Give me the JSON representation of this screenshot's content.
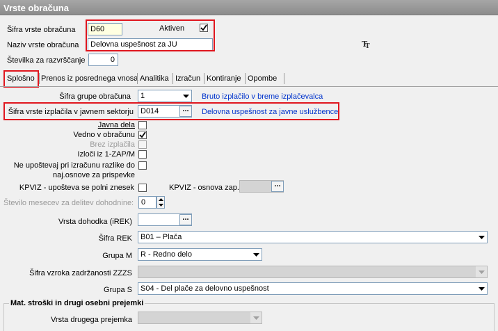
{
  "window": {
    "title": "Vrste obračuna"
  },
  "header": {
    "sifra_label": "Šifra vrste obračuna",
    "sifra_value": "D60",
    "aktiven_label": "Aktiven",
    "aktiven_checked": true,
    "naziv_label": "Naziv vrste obračuna",
    "naziv_value": "Delovna uspešnost za JU",
    "stevilka_label": "Številka  za razvrščanje",
    "stevilka_value": "0"
  },
  "tabs": [
    {
      "label": "Splošno",
      "active": true
    },
    {
      "label": "Prenos iz posrednega vnosa"
    },
    {
      "label": "Analitika"
    },
    {
      "label": "Izračun"
    },
    {
      "label": "Kontiranje"
    },
    {
      "label": "Opombe"
    }
  ],
  "general": {
    "grupa_obracuna_label": "Šifra grupe obračuna",
    "grupa_obracuna_value": "1",
    "grupa_obracuna_desc": "Bruto izplačilo v breme izplačevalca",
    "izplacila_label": "Šifra vrste izplačila v javnem sektorju",
    "izplacila_value": "D014",
    "izplacila_desc": "Delovna uspešnost za javne uslužbence",
    "javna_dela_label": "Javna dela",
    "vedno_label": "Vedno v obračunu",
    "brez_label": "Brez izplačila",
    "izloci_label": "Izloči iz 1-ZAP/M",
    "neupostevaj_label_1": "Ne upoštevaj pri izračunu razlike do",
    "neupostevaj_label_2": "naj.osnove za prispevke",
    "kpviz_polni_label": "KPVIZ - upošteva se polni znesek",
    "kpviz_osnova_label": "KPVIZ - osnova zap.",
    "stevilo_mesecev_label": "Število mesecev za delitev dohodnine:",
    "stevilo_mesecev_value": "0",
    "vrsta_dohodka_label": "Vrsta dohodka (iREK)",
    "sifra_rek_label": "Šifra REK",
    "sifra_rek_value": "B01 – Plača",
    "grupa_m_label": "Grupa M",
    "grupa_m_value": "R - Redno delo",
    "zzzs_label": "Šifra vzroka zadržanosti ZZZS",
    "grupa_s_label": "Grupa S",
    "grupa_s_value": "S04 - Del plače za delovno uspešnost"
  },
  "mat_stroski": {
    "title": "Mat. stroški in drugi osebni prejemki",
    "vrsta_label": "Vrsta drugega prejemka"
  },
  "icons": {
    "font_button": "font-icon",
    "dropdown": "chevron-down-icon",
    "browse": "ellipsis-icon"
  }
}
